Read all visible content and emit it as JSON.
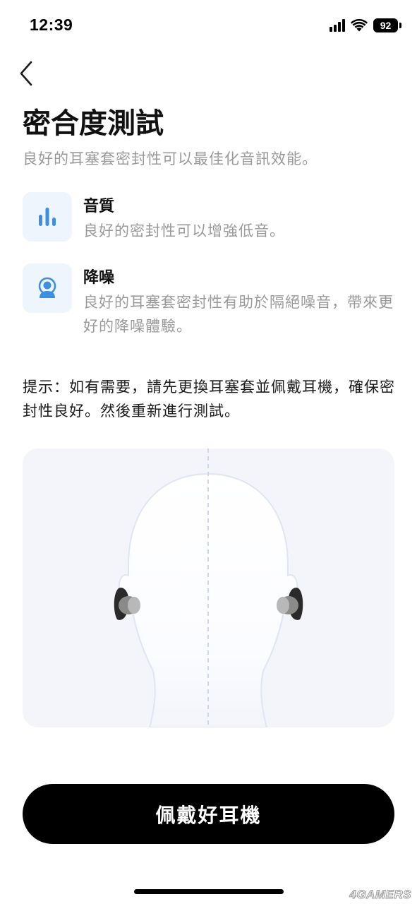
{
  "status_bar": {
    "time": "12:39",
    "battery": "92",
    "icons": [
      "signal-icon",
      "wifi-icon",
      "battery-icon"
    ]
  },
  "header": {
    "back_icon": "chevron-left-icon",
    "title": "密合度測試",
    "subtitle": "良好的耳塞套密封性可以最佳化音訊效能。"
  },
  "features": [
    {
      "icon": "sound-quality-bars-icon",
      "title": "音質",
      "description": "良好的密封性可以增強低音。"
    },
    {
      "icon": "noise-cancelling-person-icon",
      "title": "降噪",
      "description": "良好的耳塞套密封性有助於隔絕噪音，帶來更好的降噪體驗。"
    }
  ],
  "tip": "提示：如有需要，請先更換耳塞套並佩戴耳機，確保密封性良好。然後重新進行測試。",
  "illustration": {
    "icon": "head-with-earbuds-illustration"
  },
  "primary_button": {
    "label": "佩戴好耳機"
  },
  "watermark": "4GAMERS",
  "colors": {
    "accent": "#3d8fe0",
    "icon_background": "#eef5fc",
    "secondary_text": "#9a9a9a",
    "button_background": "#000000",
    "illustration_background": "#f3f5fb"
  }
}
